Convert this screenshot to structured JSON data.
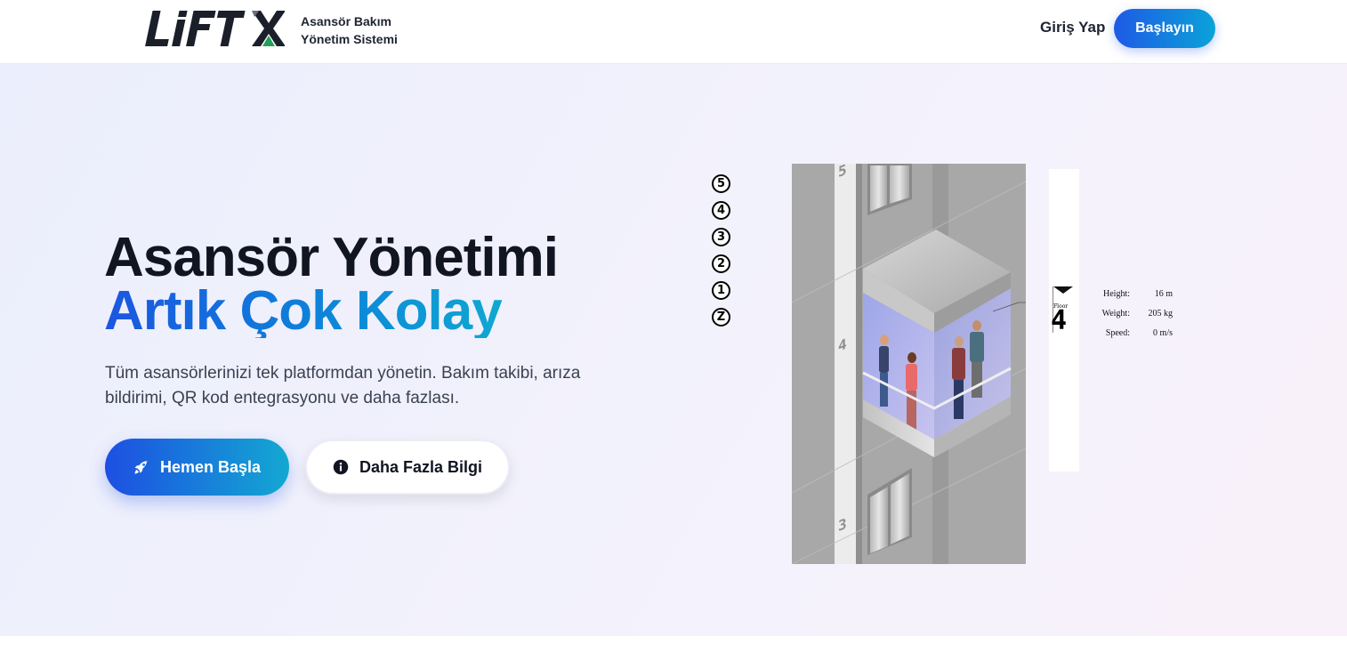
{
  "header": {
    "tagline_line1": "Asansör Bakım",
    "tagline_line2": "Yönetim Sistemi",
    "login_label": "Giriş Yap",
    "start_label": "Başlayın",
    "logo_alt": "LiFTX"
  },
  "hero": {
    "title_line1": "Asansör Yönetimi",
    "title_line2": "Artık Çok Kolay",
    "description": "Tüm asansörlerinizi tek platformdan yönetin. Bakım takibi, arıza bildirimi, QR kod entegrasyonu ve daha fazlası.",
    "primary_button": "Hemen Başla",
    "secondary_button": "Daha Fazla Bilgi"
  },
  "elevator_widget": {
    "floor_buttons": [
      "5",
      "4",
      "3",
      "2",
      "1",
      "Z"
    ],
    "floor_label": "Floor",
    "current_floor": "4",
    "direction": "down",
    "shaft_floor_numbers": [
      "5",
      "4",
      "3"
    ],
    "stats": [
      {
        "label": "Height:",
        "value": "16 m"
      },
      {
        "label": "Weight:",
        "value": "205 kg"
      },
      {
        "label": "Speed:",
        "value": "0 m/s"
      }
    ]
  },
  "colors": {
    "brand_blue": "#1e5ae6",
    "brand_cyan": "#0aa3d8",
    "logo_dark": "#1b1f2a",
    "logo_green": "#22a05a",
    "text_dark": "#111522"
  },
  "icons": {
    "primary_button_icon": "rocket-icon",
    "secondary_button_icon": "info-circle-icon"
  }
}
